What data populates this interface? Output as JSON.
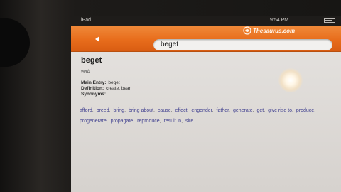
{
  "status_bar": {
    "device": "iPad",
    "time": "9:54 PM"
  },
  "toolbar": {
    "brand": "Thesaurus.com",
    "search_value": "beget",
    "back_icon": "back-arrow-icon"
  },
  "entry": {
    "headword": "beget",
    "part_of_speech": "verb",
    "main_entry_label": "Main Entry:",
    "main_entry_value": "beget",
    "definition_label": "Definition:",
    "definition_value": "create, bear",
    "synonyms_label": "Synonyms:",
    "synonyms": [
      "afford",
      "breed",
      "bring",
      "bring about",
      "cause",
      "effect",
      "engender",
      "father",
      "generate",
      "get",
      "give rise to",
      "produce",
      "progenerate",
      "propagate",
      "reproduce",
      "result in",
      "sire"
    ]
  },
  "colors": {
    "toolbar_orange": "#e86d1c",
    "link_blue": "#3f3f8f",
    "page_background": "#d9d6d3"
  }
}
